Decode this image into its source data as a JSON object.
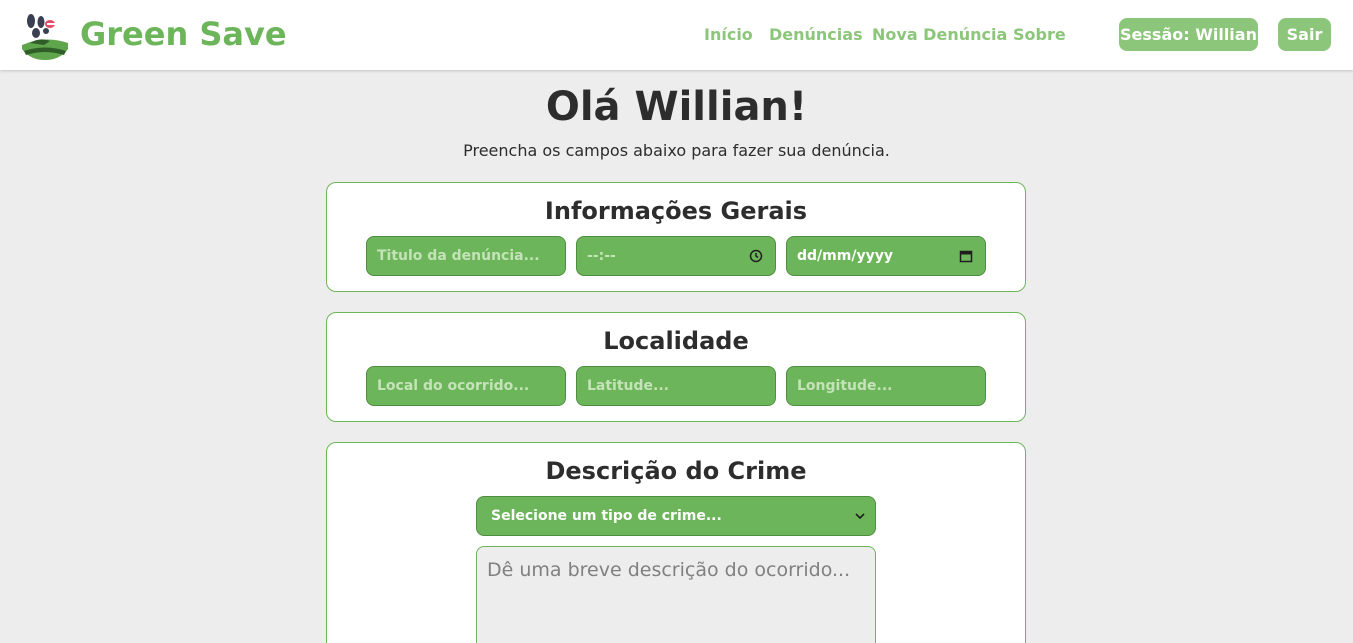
{
  "header": {
    "brand": "Green Save",
    "nav": [
      "Início",
      "Denúncias",
      "Nova Denúncia",
      "Sobre"
    ],
    "session_label": "Sessão: Willian",
    "logout_label": "Sair"
  },
  "main": {
    "greeting": "Olá Willian!",
    "subtitle": "Preencha os campos abaixo para fazer sua denúncia."
  },
  "sections": {
    "general": {
      "title": "Informações Gerais",
      "title_placeholder": "Titulo da denúncia...",
      "time_placeholder": "--:--",
      "date_placeholder": "dd/mm/yyyy"
    },
    "location": {
      "title": "Localidade",
      "place_placeholder": "Local do ocorrido...",
      "lat_placeholder": "Latitude...",
      "lng_placeholder": "Longitude..."
    },
    "description": {
      "title": "Descrição do Crime",
      "select_value": "Selecione um tipo de crime...",
      "textarea_placeholder": "Dê uma breve descrição do ocorrido..."
    }
  },
  "colors": {
    "accent": "#6db55a",
    "accent_light": "#8cc67a",
    "background": "#ededed"
  }
}
